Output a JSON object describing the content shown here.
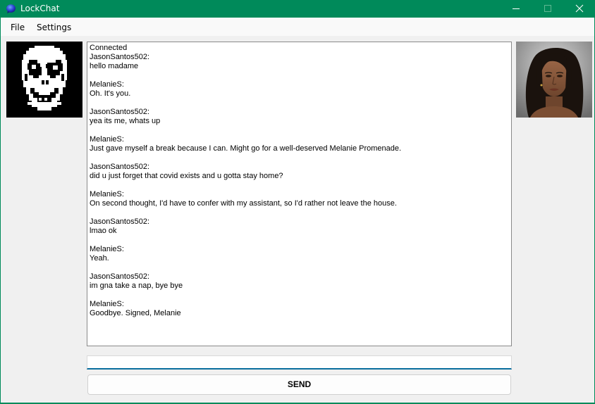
{
  "window": {
    "title": "LockChat",
    "icon": "bubble-icon",
    "controls": [
      "minimize-icon",
      "maximize-icon",
      "close-icon"
    ],
    "accent": "#008a5a"
  },
  "menu": {
    "file": "File",
    "settings": "Settings"
  },
  "avatars": {
    "self": "pixel-skull-avatar",
    "contact": "woman-portrait-avatar"
  },
  "chat": {
    "lines": [
      "Connected",
      "JasonSantos502:",
      "hello madame",
      "",
      "MelanieS:",
      "Oh. It's you.",
      "",
      "JasonSantos502:",
      "yea its me, whats up",
      "",
      "MelanieS:",
      "Just gave myself a break because I can. Might go for a well-deserved Melanie Promenade.",
      "",
      "JasonSantos502:",
      "did u just forget that covid exists and u gotta stay home?",
      "",
      "MelanieS:",
      "On second thought, I'd have to confer with my assistant, so I'd rather not leave the house.",
      "",
      "JasonSantos502:",
      "lmao ok",
      "",
      "MelanieS:",
      "Yeah.",
      "",
      "JasonSantos502:",
      "im gna take a nap, bye bye",
      "",
      "MelanieS:",
      "Goodbye. Signed, Melanie"
    ]
  },
  "composer": {
    "value": "",
    "send_label": "SEND"
  }
}
